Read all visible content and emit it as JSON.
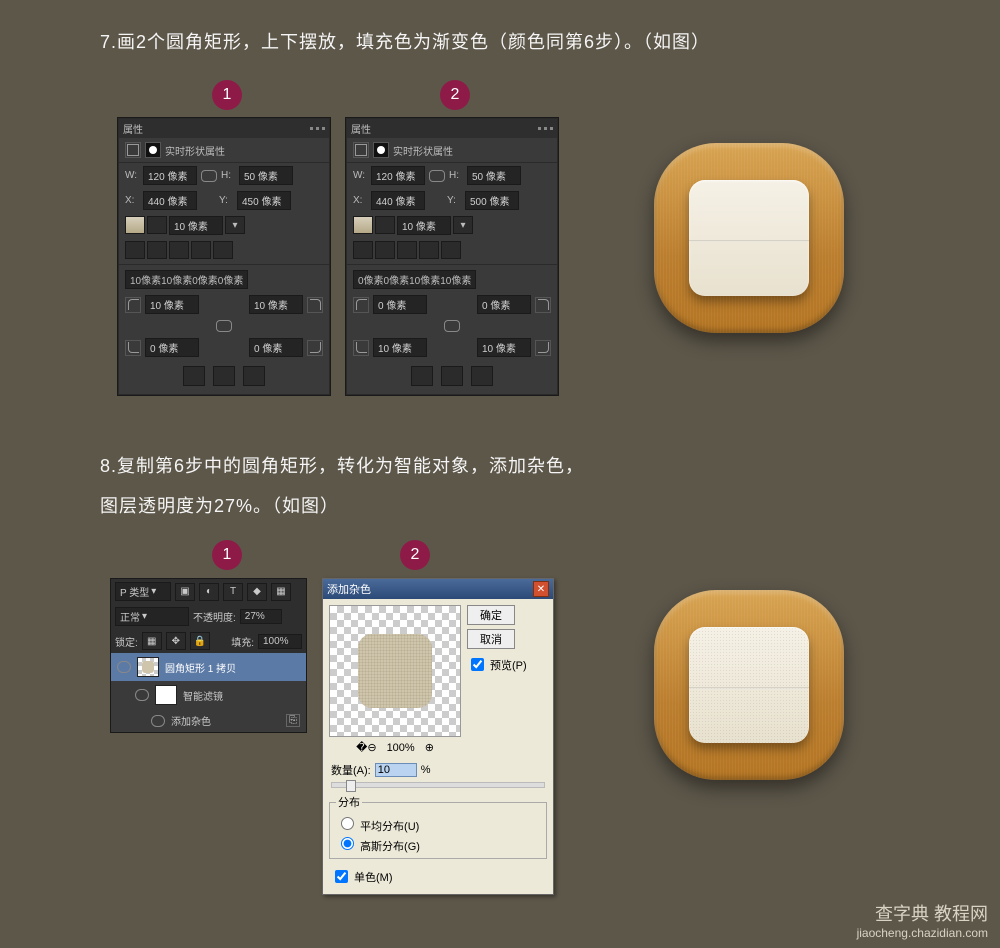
{
  "step7": {
    "title": "7.画2个圆角矩形，上下摆放，填充色为渐变色（颜色同第6步）。（如图）",
    "badge1": "1",
    "badge2": "2",
    "panel": {
      "title": "属性",
      "subhead": "实时形状属性",
      "w_label": "W:",
      "h_label": "H:",
      "x_label": "X:",
      "y_label": "Y:"
    },
    "p1": {
      "w": "120 像素",
      "h": "50 像素",
      "x": "440 像素",
      "y": "450 像素",
      "stroke": "10 像素",
      "corner_summary": "10像素10像素0像素0像素",
      "c_tl": "10 像素",
      "c_tr": "10 像素",
      "c_bl": "0 像素",
      "c_br": "0 像素"
    },
    "p2": {
      "w": "120 像素",
      "h": "50 像素",
      "x": "440 像素",
      "y": "500 像素",
      "stroke": "10 像素",
      "corner_summary": "0像素0像素10像素10像素",
      "c_tl": "0 像素",
      "c_tr": "0 像素",
      "c_bl": "10 像素",
      "c_br": "10 像素"
    }
  },
  "step8": {
    "title_line1": "8.复制第6步中的圆角矩形，转化为智能对象，添加杂色，",
    "title_line2": "图层透明度为27%。（如图）",
    "badge1": "1",
    "badge2": "2",
    "layers": {
      "kind_label": "P 类型",
      "blend": "正常",
      "opacity_label": "不透明度:",
      "opacity_value": "27%",
      "lock_label": "锁定:",
      "fill_label": "填充:",
      "fill_value": "100%",
      "layer_name": "圆角矩形 1 拷贝",
      "smart_filters": "智能滤镜",
      "add_noise_row": "添加杂色"
    },
    "noise": {
      "title": "添加杂色",
      "ok": "确定",
      "cancel": "取消",
      "preview": "预览(P)",
      "zoom": "100%",
      "amount_label": "数量(A):",
      "amount_value": "10",
      "percent": "%",
      "dist_legend": "分布",
      "uniform": "平均分布(U)",
      "gaussian": "高斯分布(G)",
      "mono": "单色(M)"
    }
  },
  "watermark": {
    "main": "查字典 教程网",
    "sub": "jiaocheng.chazidian.com"
  }
}
